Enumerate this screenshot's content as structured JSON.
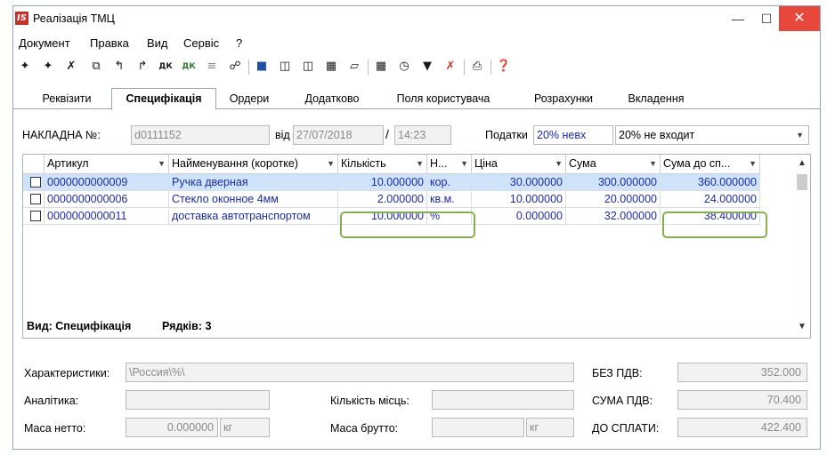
{
  "window": {
    "title": "Реалізація ТМЦ",
    "logo": "IS"
  },
  "menu": [
    "Документ",
    "Правка",
    "Вид",
    "Сервіс",
    "?"
  ],
  "toolbar_icons": [
    "new-doc-icon",
    "copy-doc-icon",
    "delete-doc-icon",
    "duplicate-icon",
    "insert-icon",
    "paste-icon",
    "dk-icon",
    "dk-alt-icon",
    "calc-icon",
    "link-icon",
    "save-icon",
    "book-icon",
    "book-open-icon",
    "tree-edit-icon",
    "hierarchy-icon",
    "table-icon",
    "clock-icon",
    "filter-icon",
    "clear-filter-icon",
    "print-icon",
    "help-icon"
  ],
  "tabs": [
    "Реквізити",
    "Специфікація",
    "Ордери",
    "Додатково",
    "Поля користувача",
    "Розрахунки",
    "Вкладення"
  ],
  "header": {
    "invoice_label": "НАКЛАДНА №:",
    "invoice_no": "d0111152",
    "from_label": "від",
    "date": "27/07/2018",
    "time": "14:23",
    "taxes_label": "Податки",
    "tax1": "20% невх",
    "tax2": "20% не входит"
  },
  "grid": {
    "columns": [
      "Артикул",
      "Найменування (коротке)",
      "Кількість",
      "Н...",
      "Ціна",
      "Сума",
      "Сума до сп..."
    ],
    "rows": [
      {
        "article": "0000000000009",
        "name": "Ручка дверная",
        "qty": "10.000000",
        "unit": "кор.",
        "price": "30.000000",
        "sum": "300.000000",
        "total": "360.000000"
      },
      {
        "article": "0000000000006",
        "name": "Стекло оконное 4мм",
        "qty": "2.000000",
        "unit": "кв.м.",
        "price": "10.000000",
        "sum": "20.000000",
        "total": "24.000000"
      },
      {
        "article": "0000000000011",
        "name": "доставка автотранспортом",
        "qty": "10.000000",
        "unit": "%",
        "price": "0.000000",
        "sum": "32.000000",
        "total": "38.400000"
      }
    ],
    "view_label": "Вид: Специфікація",
    "rows_label": "Рядків: 3"
  },
  "bottom": {
    "char_label": "Характеристики:",
    "char_value": "\\Россия\\%\\",
    "analytics_label": "Аналітика:",
    "places_label": "Кількість місць:",
    "net_label": "Маса нетто:",
    "net_value": "0.000000",
    "net_unit": "кг",
    "gross_label": "Маса брутто:",
    "gross_unit": "кг",
    "no_vat_label": "БЕЗ ПДВ:",
    "no_vat_value": "352.000",
    "vat_label": "СУМА ПДВ:",
    "vat_value": "70.400",
    "pay_label": "ДО СПЛАТИ:",
    "pay_value": "422.400"
  }
}
